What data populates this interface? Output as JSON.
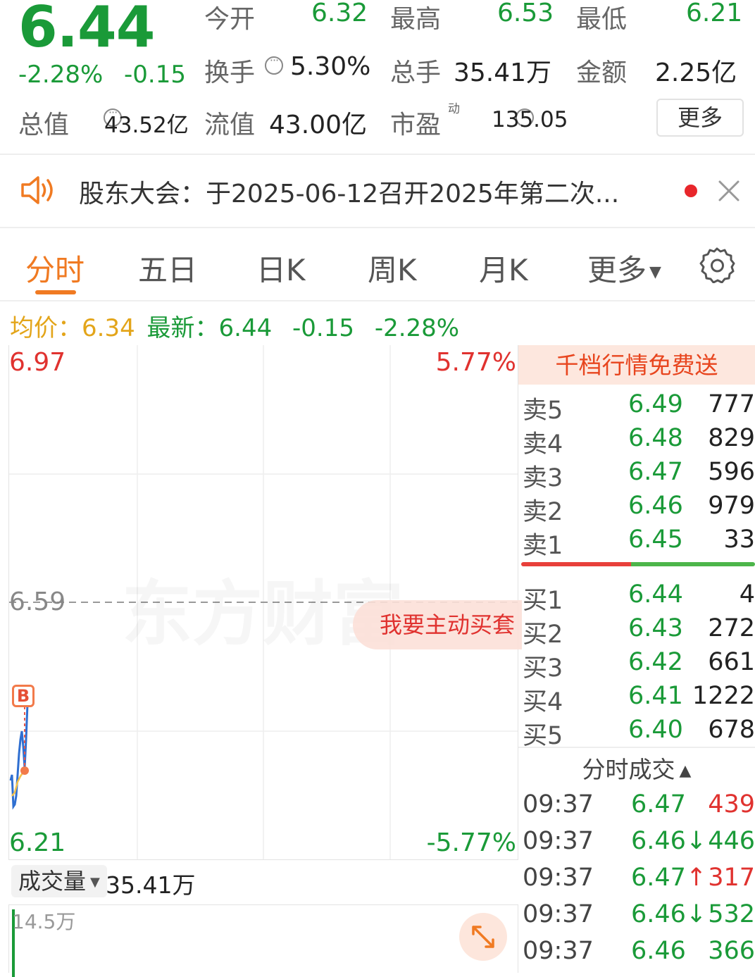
{
  "quote": {
    "price": "6.44",
    "change_pct": "-2.28%",
    "change": "-0.15",
    "open_label": "今开",
    "open": "6.32",
    "high_label": "最高",
    "high": "6.53",
    "low_label": "最低",
    "low": "6.21",
    "turnover_label": "换手",
    "turnover": "5.30%",
    "volume_label": "总手",
    "volume": "35.41万",
    "amount_label": "金额",
    "amount": "2.25亿",
    "mktcap_label": "总值",
    "mktcap": "43.52亿",
    "float_label": "流值",
    "float": "43.00亿",
    "pe_label": "市盈",
    "pe_sup": "动",
    "pe": "135.05",
    "more_label": "更多"
  },
  "notice": {
    "text": "股东大会：于2025-06-12召开2025年第二次..."
  },
  "tabs": [
    "分时",
    "五日",
    "日K",
    "周K",
    "月K",
    "更多"
  ],
  "summary": {
    "avg_label": "均价：",
    "avg": "6.34",
    "last_label": "最新：",
    "last": "6.44",
    "chg": "-0.15",
    "chg_pct": "-2.28%"
  },
  "chart": {
    "top_price": "6.97",
    "top_pct": "5.77%",
    "mid_price": "6.59",
    "bottom_price": "6.21",
    "bottom_pct": "-5.77%",
    "watermark": "东方财富",
    "promo": "我要主动买套",
    "marker": "B"
  },
  "order_book": {
    "header": "千档行情免费送",
    "asks": [
      {
        "label": "卖5",
        "price": "6.49",
        "vol": "777"
      },
      {
        "label": "卖4",
        "price": "6.48",
        "vol": "829"
      },
      {
        "label": "卖3",
        "price": "6.47",
        "vol": "596"
      },
      {
        "label": "卖2",
        "price": "6.46",
        "vol": "979"
      },
      {
        "label": "卖1",
        "price": "6.45",
        "vol": "33"
      }
    ],
    "bids": [
      {
        "label": "买1",
        "price": "6.44",
        "vol": "4"
      },
      {
        "label": "买2",
        "price": "6.43",
        "vol": "272"
      },
      {
        "label": "买3",
        "price": "6.42",
        "vol": "661"
      },
      {
        "label": "买4",
        "price": "6.41",
        "vol": "1222"
      },
      {
        "label": "买5",
        "price": "6.40",
        "vol": "678"
      }
    ]
  },
  "ticks": {
    "title": "分时成交",
    "rows": [
      {
        "time": "09:37",
        "price": "6.47",
        "arrow": "",
        "vol": "439",
        "vol_color": "#e0322f"
      },
      {
        "time": "09:37",
        "price": "6.46",
        "arrow": "↓",
        "vol": "446",
        "vol_color": "#1a9a38"
      },
      {
        "time": "09:37",
        "price": "6.47",
        "arrow": "↑",
        "vol": "317",
        "vol_color": "#e0322f"
      },
      {
        "time": "09:37",
        "price": "6.46",
        "arrow": "↓",
        "vol": "532",
        "vol_color": "#1a9a38"
      },
      {
        "time": "09:37",
        "price": "6.46",
        "arrow": "",
        "vol": "366",
        "vol_color": "#1a9a38"
      }
    ]
  },
  "volume": {
    "select_label": "成交量",
    "value": "35.41万",
    "axis_max": "14.5万"
  },
  "colors": {
    "up": "#e0322f",
    "down": "#1a9a38",
    "accent": "#f07a22",
    "avg": "#e3a51a"
  }
}
